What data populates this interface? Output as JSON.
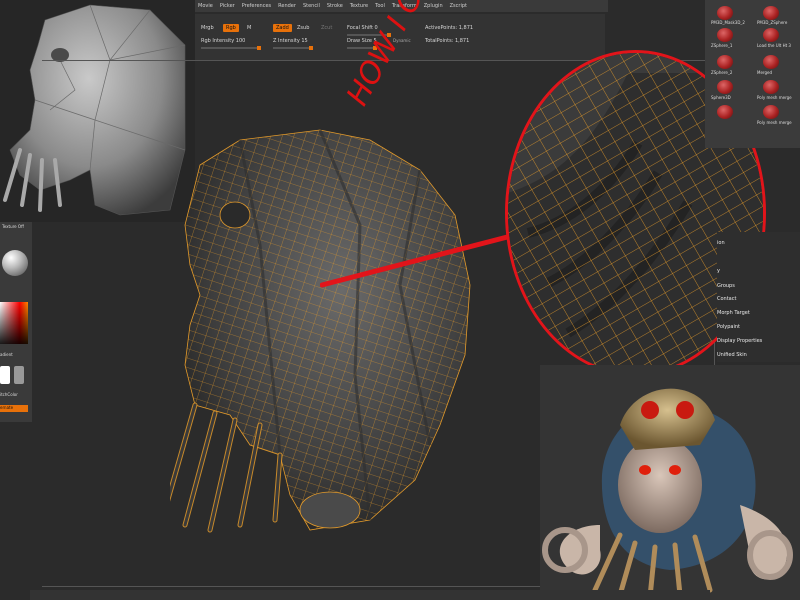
{
  "menu": {
    "items": [
      "Movie",
      "Picker",
      "Preferences",
      "Render",
      "Stencil",
      "Stroke",
      "Texture",
      "Tool",
      "Transform",
      "Zplugin",
      "Zscript"
    ]
  },
  "toolbar": {
    "mrgb": "Mrgb",
    "rgb": "Rgb",
    "m": "M",
    "zadd": "Zadd",
    "zsub": "Zsub",
    "zcut": "Zcut",
    "rgb_intensity": "Rgb Intensity 100",
    "z_intensity": "Z Intensity 15",
    "focal_shift": "Focal Shift 0",
    "draw_size": "Draw Size 5",
    "dynamic": "Dynamic",
    "active_points": "ActivePoints: 1,871",
    "total_points": "TotalPoints: 1,871"
  },
  "tool_palette": {
    "tools": [
      {
        "label": "PM3D_Mask3D_2"
      },
      {
        "label": "PM3D_ZSphere"
      },
      {
        "label": "ZSphere_1"
      },
      {
        "label": "Load the Ult Ht 3"
      },
      {
        "label": "ZSphere_2"
      },
      {
        "label": "Merged"
      },
      {
        "label": "Sphere3D"
      },
      {
        "label": "Poly mesh merge"
      },
      {
        "label": ""
      },
      {
        "label": "Poly mesh merge"
      }
    ]
  },
  "subtool_menu": {
    "items": [
      "ion",
      "y",
      "Groups",
      "Contact",
      "Morph Target",
      "Polypaint",
      "Display Properties",
      "Unified Skin"
    ]
  },
  "left_panel": {
    "material_label": "Texture Off",
    "gradient_label": "adient",
    "switch_color_label": "itchColor",
    "alternate_label": "ernate"
  },
  "annotation": {
    "text": "HOW I CAN SOLVE THIS?",
    "color": "#d61010"
  },
  "colors": {
    "accent": "#e8710a",
    "wire": "#e39a2a",
    "background": "#2b2b2b"
  }
}
